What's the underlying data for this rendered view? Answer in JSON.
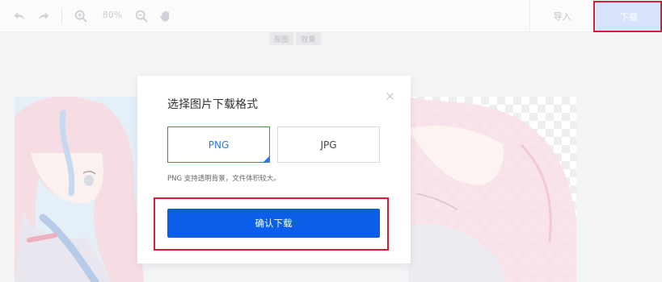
{
  "toolbar": {
    "zoom_level": "80%",
    "import_label": "导入",
    "download_label": "下载",
    "icons": [
      "undo-icon",
      "redo-icon",
      "zoom-in-icon",
      "zoom-out-icon",
      "hand-pan-icon"
    ]
  },
  "compare_tags": {
    "original": "原图",
    "result": "效果"
  },
  "modal": {
    "title": "选择图片下载格式",
    "close_icon": "close-icon",
    "formats": [
      {
        "label": "PNG",
        "selected": true
      },
      {
        "label": "JPG",
        "selected": false
      }
    ],
    "hint": "PNG 支持透明背景，文件体积较大。",
    "confirm_label": "确认下载"
  },
  "colors": {
    "accent": "#0a5eea",
    "selected_border": "#2f76f0",
    "highlight": "#cc2233",
    "download_button_bg": "#d7e3fb"
  }
}
